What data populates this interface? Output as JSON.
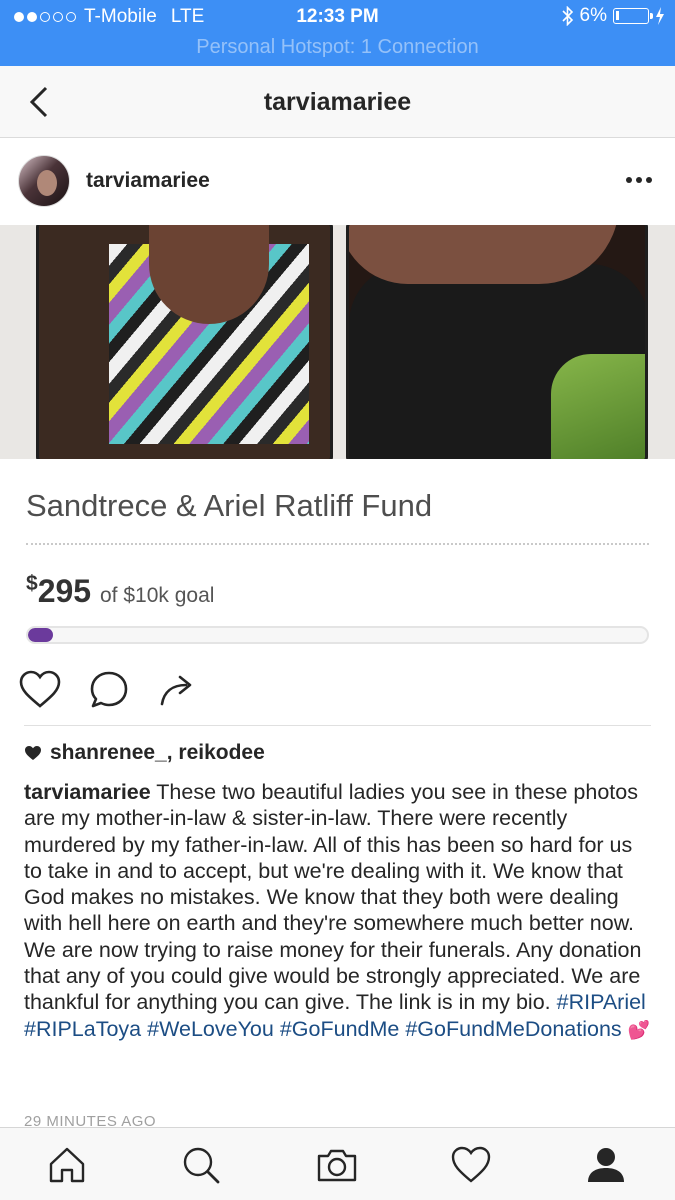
{
  "status_bar": {
    "carrier": "T-Mobile",
    "network": "LTE",
    "time": "12:33 PM",
    "battery": "6%",
    "hotspot": "Personal Hotspot: 1 Connection"
  },
  "nav": {
    "title": "tarviamariee"
  },
  "post": {
    "username": "tarviamariee",
    "fund_title": "Sandtrece & Ariel Ratliff Fund",
    "amount_symbol": "$",
    "amount_raised": "295",
    "goal_text": "of $10k goal",
    "progress_fraction": 0.0295,
    "liked_by": "shanrenee_, reikodee",
    "caption_user": "tarviamariee",
    "caption_text": "These two beautiful ladies you see in these photos are my mother-in-law & sister-in-law. There were recently murdered by my father-in-law. All of this has been so hard for us to take in and to accept, but we're dealing with it. We know that God makes no mistakes. We know that they both were dealing with hell here on earth and they're somewhere much better now. We are now trying to raise money for their funerals. Any donation that any of you could give would be strongly appreciated. We are thankful for anything you can give. The link is in my bio.",
    "hashtags": [
      "#RIPAriel",
      "#RIPLaToya",
      "#WeLoveYou",
      "#GoFundMe",
      "#GoFundMeDonations"
    ],
    "emoji": "💕",
    "time_ago": "29 MINUTES AGO"
  },
  "icons": {
    "back": "chevron-left-icon",
    "more": "more-icon",
    "like": "heart-icon",
    "comment": "comment-icon",
    "share": "share-icon",
    "tabs": [
      "home-icon",
      "search-icon",
      "camera-icon",
      "activity-heart-icon",
      "profile-icon"
    ]
  },
  "colors": {
    "status_bar": "#3d8ff5",
    "progress": "#6b3a9c",
    "hashtag": "#1c4d84"
  }
}
